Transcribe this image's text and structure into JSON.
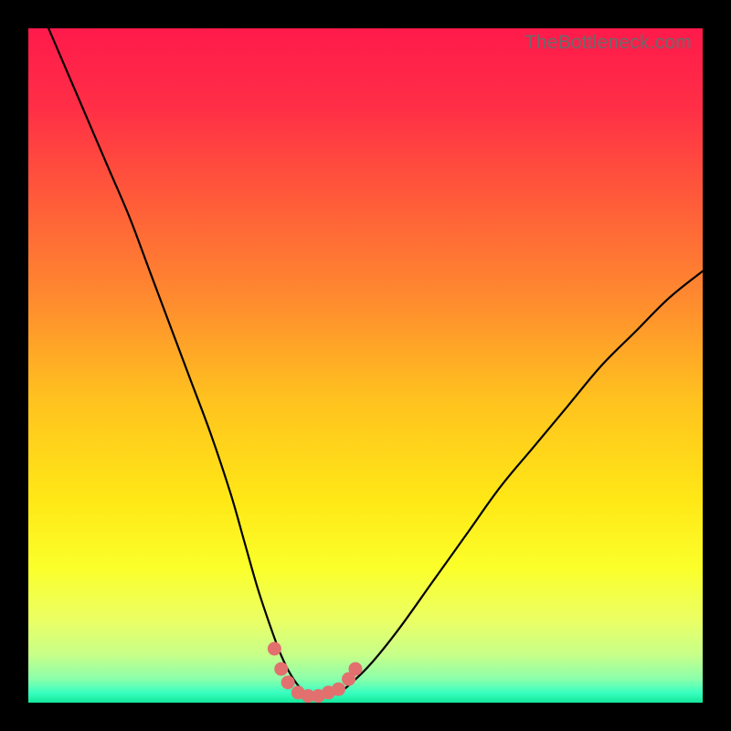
{
  "watermark": "TheBottleneck.com",
  "chart_data": {
    "type": "line",
    "title": "",
    "xlabel": "",
    "ylabel": "",
    "xlim": [
      0,
      100
    ],
    "ylim": [
      0,
      100
    ],
    "series": [
      {
        "name": "bottleneck-curve",
        "x": [
          3,
          6,
          9,
          12,
          15,
          18,
          21,
          24,
          27,
          30,
          32,
          34,
          36,
          37.5,
          39,
          40.5,
          42,
          44,
          46,
          48,
          51,
          55,
          60,
          65,
          70,
          75,
          80,
          85,
          90,
          95,
          100
        ],
        "y": [
          100,
          93,
          86,
          79,
          72,
          64,
          56,
          48,
          40,
          31,
          24,
          17,
          11,
          7,
          4,
          2,
          1,
          1,
          1.5,
          3,
          6,
          11,
          18,
          25,
          32,
          38,
          44,
          50,
          55,
          60,
          64
        ]
      },
      {
        "name": "highlight-dots",
        "x": [
          36.5,
          37.5,
          38.5,
          40,
          41.5,
          43,
          44.5,
          46,
          47.5,
          48.5
        ],
        "y": [
          8,
          5,
          3,
          1.5,
          1,
          1,
          1.5,
          2,
          3.5,
          5
        ]
      }
    ],
    "gradient_stops": [
      {
        "offset": 0.0,
        "color": "#ff1a4b"
      },
      {
        "offset": 0.12,
        "color": "#ff2f46"
      },
      {
        "offset": 0.25,
        "color": "#ff5a3a"
      },
      {
        "offset": 0.4,
        "color": "#ff8a2f"
      },
      {
        "offset": 0.55,
        "color": "#ffc21f"
      },
      {
        "offset": 0.7,
        "color": "#ffe816"
      },
      {
        "offset": 0.8,
        "color": "#fbff2a"
      },
      {
        "offset": 0.88,
        "color": "#eaff66"
      },
      {
        "offset": 0.93,
        "color": "#c6ff8a"
      },
      {
        "offset": 0.965,
        "color": "#8affab"
      },
      {
        "offset": 0.985,
        "color": "#3affc0"
      },
      {
        "offset": 1.0,
        "color": "#12e89a"
      }
    ]
  }
}
